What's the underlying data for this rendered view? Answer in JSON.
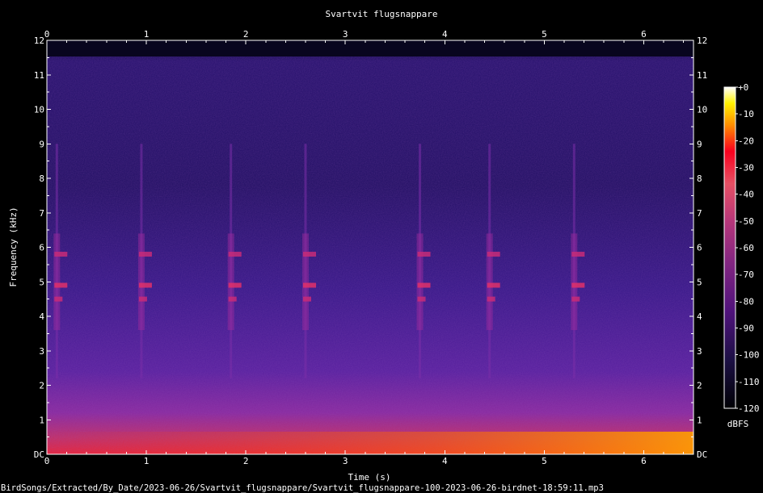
{
  "chart_data": {
    "type": "heatmap",
    "title": "Svartvit flugsnappare",
    "xlabel": "Time (s)",
    "ylabel": "Frequency (kHz)",
    "x_ticks": [
      "0",
      "1",
      "2",
      "3",
      "4",
      "5",
      "6"
    ],
    "xlim": [
      0,
      6.5
    ],
    "y_ticks": [
      "DC",
      "1",
      "2",
      "3",
      "4",
      "5",
      "6",
      "7",
      "8",
      "9",
      "10",
      "11",
      "12"
    ],
    "ylim": [
      0,
      12
    ],
    "colorbar": {
      "label": "dBFS",
      "ticks": [
        "+0",
        "-10",
        "-20",
        "-30",
        "-40",
        "-50",
        "-60",
        "-70",
        "-80",
        "-90",
        "-100",
        "-110",
        "-120"
      ],
      "range": [
        -120,
        0
      ],
      "colormap": "magma"
    },
    "grid": false,
    "calls_time_s": [
      0.1,
      0.95,
      1.85,
      2.6,
      3.75,
      4.45,
      5.3
    ],
    "call_bands_khz": [
      5.8,
      4.9,
      4.5
    ],
    "footer": "BirdSongs/Extracted/By_Date/2023-06-26/Svartvit_flugsnappare/Svartvit_flugsnappare-100-2023-06-26-birdnet-18:59:11.mp3"
  }
}
